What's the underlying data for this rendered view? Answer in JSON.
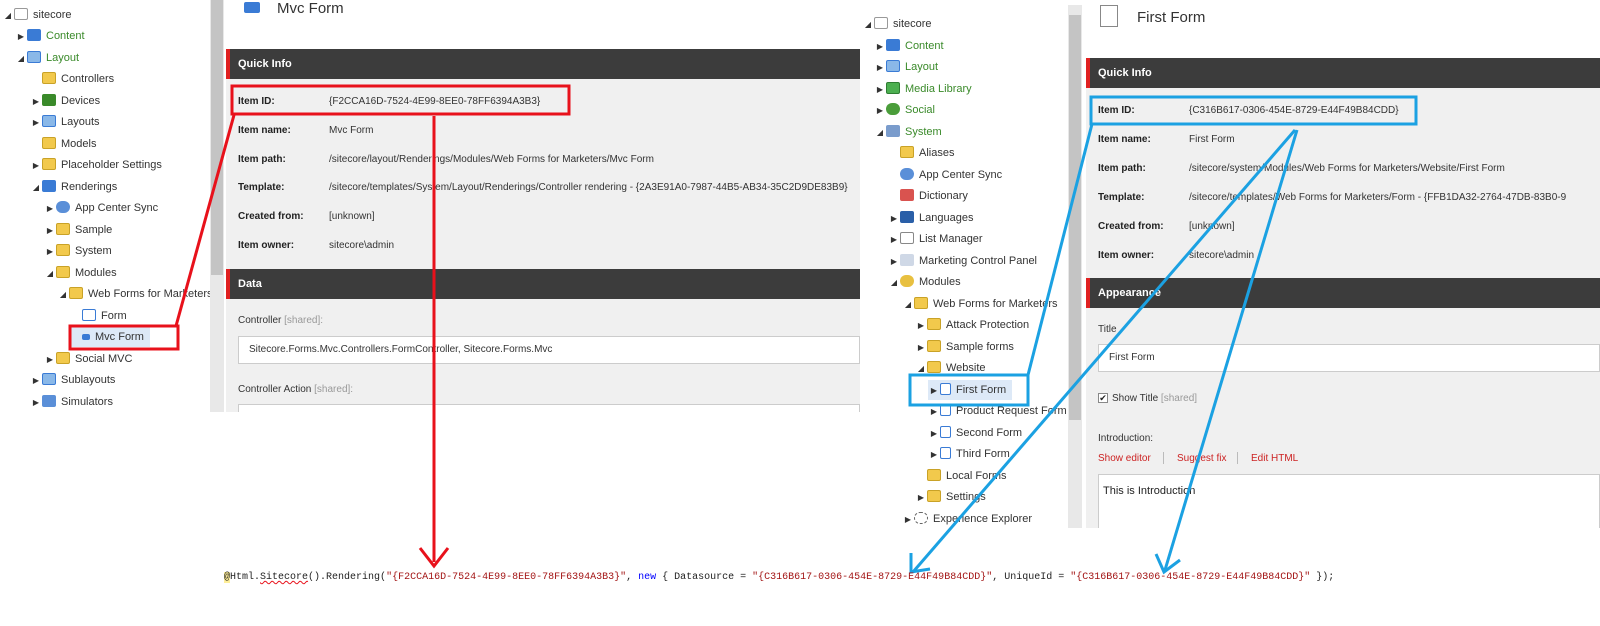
{
  "left_tree": {
    "items": [
      {
        "label": "sitecore"
      },
      {
        "label": "Content"
      },
      {
        "label": "Layout"
      },
      {
        "label": "Controllers"
      },
      {
        "label": "Devices"
      },
      {
        "label": "Layouts"
      },
      {
        "label": "Models"
      },
      {
        "label": "Placeholder Settings"
      },
      {
        "label": "Renderings"
      },
      {
        "label": "App Center Sync"
      },
      {
        "label": "Sample"
      },
      {
        "label": "System"
      },
      {
        "label": "Modules"
      },
      {
        "label": "Web Forms for Marketers"
      },
      {
        "label": "Form"
      },
      {
        "label": "Mvc Form"
      },
      {
        "label": "Social MVC"
      },
      {
        "label": "Sublayouts"
      },
      {
        "label": "Simulators"
      }
    ]
  },
  "left_panel": {
    "title": "Mvc Form",
    "quick_info_header": "Quick Info",
    "fields": [
      {
        "label": "Item ID:",
        "value": "{F2CCA16D-7524-4E99-8EE0-78FF6394A3B3}"
      },
      {
        "label": "Item name:",
        "value": "Mvc Form"
      },
      {
        "label": "Item path:",
        "value": "/sitecore/layout/Renderings/Modules/Web Forms for Marketers/Mvc Form"
      },
      {
        "label": "Template:",
        "value": "/sitecore/templates/System/Layout/Renderings/Controller rendering - {2A3E91A0-7987-44B5-AB34-35C2D9DE83B9}"
      },
      {
        "label": "Created from:",
        "value": "[unknown]"
      },
      {
        "label": "Item owner:",
        "value": "sitecore\\admin"
      }
    ],
    "data_header": "Data",
    "controller_label": "Controller",
    "shared_tag": "[shared]:",
    "controller_value": "Sitecore.Forms.Mvc.Controllers.FormController, Sitecore.Forms.Mvc",
    "controller_action_label": "Controller Action"
  },
  "right_tree": {
    "items": [
      {
        "label": "sitecore"
      },
      {
        "label": "Content"
      },
      {
        "label": "Layout"
      },
      {
        "label": "Media Library"
      },
      {
        "label": "Social"
      },
      {
        "label": "System"
      },
      {
        "label": "Aliases"
      },
      {
        "label": "App Center Sync"
      },
      {
        "label": "Dictionary"
      },
      {
        "label": "Languages"
      },
      {
        "label": "List Manager"
      },
      {
        "label": "Marketing Control Panel"
      },
      {
        "label": "Modules"
      },
      {
        "label": "Web Forms for Marketers"
      },
      {
        "label": "Attack Protection"
      },
      {
        "label": "Sample forms"
      },
      {
        "label": "Website"
      },
      {
        "label": "First Form"
      },
      {
        "label": "Product Request Form"
      },
      {
        "label": "Second Form"
      },
      {
        "label": "Third Form"
      },
      {
        "label": "Local Forms"
      },
      {
        "label": "Settings"
      },
      {
        "label": "Experience Explorer"
      }
    ]
  },
  "right_panel": {
    "title": "First Form",
    "quick_info_header": "Quick Info",
    "fields": [
      {
        "label": "Item ID:",
        "value": "{C316B617-0306-454E-8729-E44F49B84CDD}"
      },
      {
        "label": "Item name:",
        "value": "First Form"
      },
      {
        "label": "Item path:",
        "value": "/sitecore/system/Modules/Web Forms for Marketers/Website/First Form"
      },
      {
        "label": "Template:",
        "value": "/sitecore/templates/Web Forms for Marketers/Form - {FFB1DA32-2764-47DB-83B0-9"
      },
      {
        "label": "Created from:",
        "value": "[unknown]"
      },
      {
        "label": "Item owner:",
        "value": "sitecore\\admin"
      }
    ],
    "appearance_header": "Appearance",
    "title_label": "Title",
    "title_value": "First Form",
    "show_title_label": "Show Title",
    "shared_tag": "[shared]",
    "introduction_label": "Introduction:",
    "links": {
      "show_editor": "Show editor",
      "suggest_fix": "Suggest fix",
      "edit_html": "Edit HTML"
    },
    "intro_value": "This is Introduction"
  },
  "code": {
    "at": "@",
    "p1": "Html.",
    "p2": "Sitecore",
    "p3": "().Rendering(",
    "s1": "\"{F2CCA16D-7524-4E99-8EE0-78FF6394A3B3}\"",
    "p4": ", ",
    "kw": "new",
    "p5": " { Datasource = ",
    "s2": "\"{C316B617-0306-454E-8729-E44F49B84CDD}\"",
    "p6": ", UniqueId = ",
    "s3": "\"{C316B617-0306-454E-8729-E44F49B84CDD}\"",
    "p7": " });"
  },
  "colors": {
    "red_annotation": "#e8111b",
    "blue_annotation": "#1ba1e2",
    "header_bg": "#3c3c3c",
    "tree_green": "#3a8a2a",
    "link_red": "#cc2222"
  }
}
